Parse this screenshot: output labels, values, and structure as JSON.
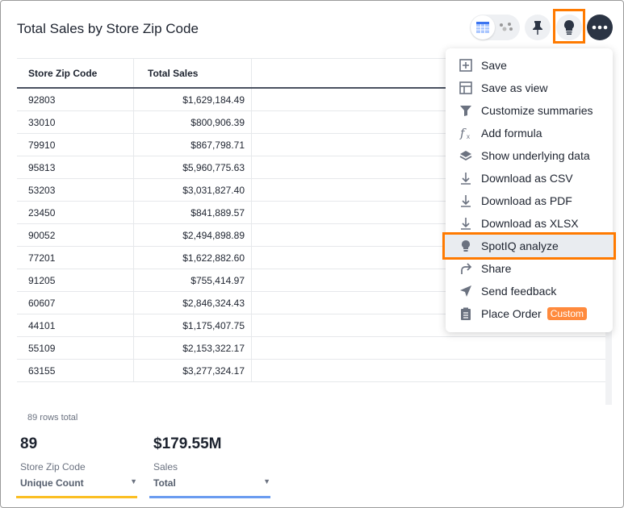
{
  "title": "Total Sales by Store Zip Code",
  "table": {
    "headers": [
      "Store Zip Code",
      "Total Sales"
    ],
    "rows": [
      [
        "92803",
        "$1,629,184.49"
      ],
      [
        "33010",
        "$800,906.39"
      ],
      [
        "79910",
        "$867,798.71"
      ],
      [
        "95813",
        "$5,960,775.63"
      ],
      [
        "53203",
        "$3,031,827.40"
      ],
      [
        "23450",
        "$841,889.57"
      ],
      [
        "90052",
        "$2,494,898.89"
      ],
      [
        "77201",
        "$1,622,882.60"
      ],
      [
        "91205",
        "$755,414.97"
      ],
      [
        "60607",
        "$2,846,324.43"
      ],
      [
        "44101",
        "$1,175,407.75"
      ],
      [
        "55109",
        "$2,153,322.17"
      ],
      [
        "63155",
        "$3,277,324.17"
      ]
    ]
  },
  "rows_total": "89 rows total",
  "summaries": [
    {
      "value": "89",
      "label": "Store Zip Code",
      "agg": "Unique Count",
      "color": "#fbbf24"
    },
    {
      "value": "$179.55M",
      "label": "Sales",
      "agg": "Total",
      "color": "#6b9cf0"
    }
  ],
  "menu": {
    "items": [
      {
        "label": "Save",
        "icon": "plus-square-icon"
      },
      {
        "label": "Save as view",
        "icon": "layout-icon"
      },
      {
        "label": "Customize summaries",
        "icon": "filter-icon"
      },
      {
        "label": "Add formula",
        "icon": "formula-icon"
      },
      {
        "label": "Show underlying data",
        "icon": "layers-icon"
      },
      {
        "label": "Download as CSV",
        "icon": "download-icon"
      },
      {
        "label": "Download as PDF",
        "icon": "download-icon"
      },
      {
        "label": "Download as XLSX",
        "icon": "download-icon"
      },
      {
        "label": "SpotIQ analyze",
        "icon": "lightbulb-icon"
      },
      {
        "label": "Share",
        "icon": "share-icon"
      },
      {
        "label": "Send feedback",
        "icon": "send-icon"
      },
      {
        "label": "Place Order",
        "icon": "clipboard-icon",
        "badge": "Custom"
      }
    ],
    "selected": "SpotIQ analyze"
  },
  "colors": {
    "accent": "#ff7a00",
    "badge": "#ff8a3d"
  }
}
